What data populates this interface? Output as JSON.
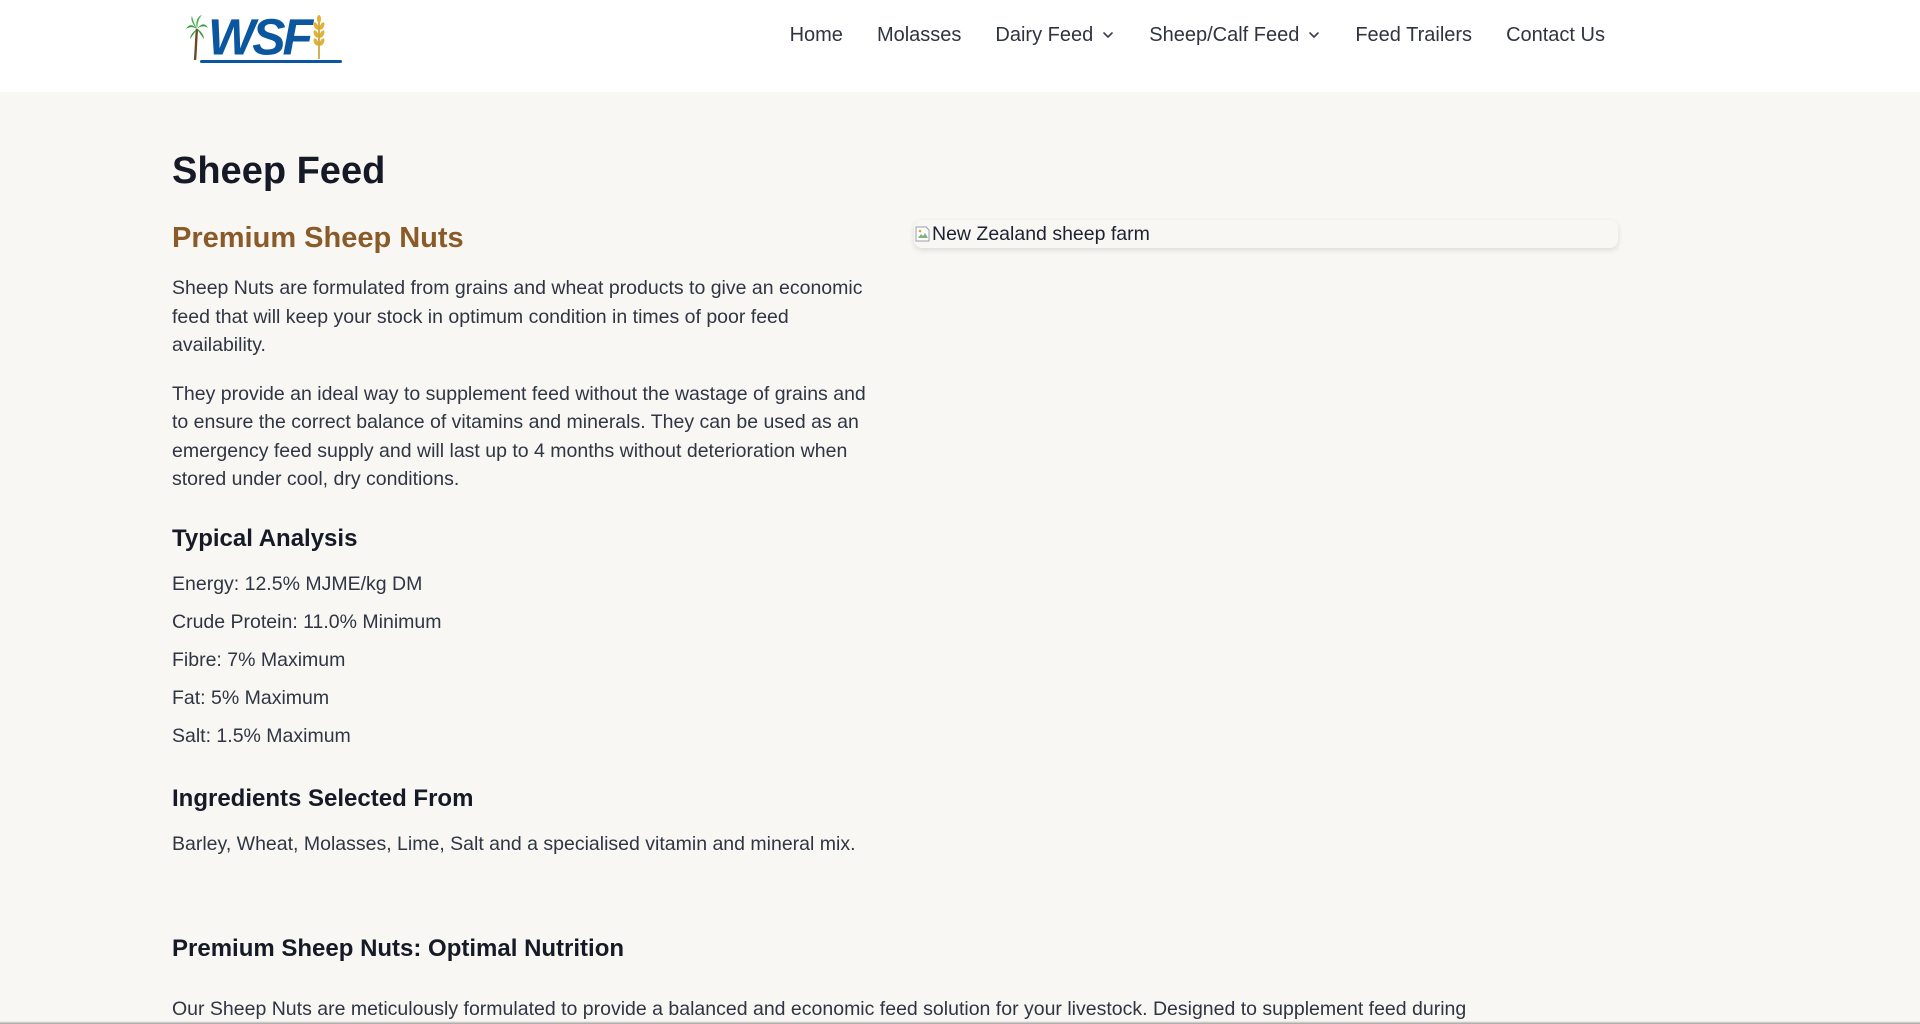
{
  "header": {
    "logo_text": "WSF",
    "nav": [
      {
        "label": "Home"
      },
      {
        "label": "Molasses"
      },
      {
        "label": "Dairy Feed"
      },
      {
        "label": "Sheep/Calf Feed"
      },
      {
        "label": "Feed Trailers"
      },
      {
        "label": "Contact Us"
      }
    ]
  },
  "main": {
    "title": "Sheep Feed",
    "subtitle": "Premium Sheep Nuts",
    "paragraphs": [
      "Sheep Nuts are formulated from grains and wheat products to give an economic feed that will keep your stock in optimum condition in times of poor feed availability.",
      "They provide an ideal way to supplement feed without the wastage of grains and to ensure the correct balance of vitamins and minerals. They can be used as an emergency feed supply and will last up to 4 months without deterioration when stored under cool, dry conditions."
    ],
    "analysis_heading": "Typical Analysis",
    "analysis": [
      "Energy: 12.5% MJME/kg DM",
      "Crude Protein: 11.0% Minimum",
      "Fibre: 7% Maximum",
      "Fat: 5% Maximum",
      "Salt: 1.5% Maximum"
    ],
    "ingredients_heading": "Ingredients Selected From",
    "ingredients_text": "Barley, Wheat, Molasses, Lime, Salt and a specialised vitamin and mineral mix.",
    "image_alt": "New Zealand sheep farm",
    "bottom_heading": "Premium Sheep Nuts: Optimal Nutrition",
    "bottom_text": "Our Sheep Nuts are meticulously formulated to provide a balanced and economic feed solution for your livestock. Designed to supplement feed during"
  },
  "colors": {
    "brand_blue": "#0a57a0",
    "accent_brown": "#8a5a28",
    "page_bg": "#f8f7f4"
  },
  "icons": [
    "palm-tree-icon",
    "wheat-icon",
    "chevron-down-icon",
    "broken-image-icon"
  ]
}
